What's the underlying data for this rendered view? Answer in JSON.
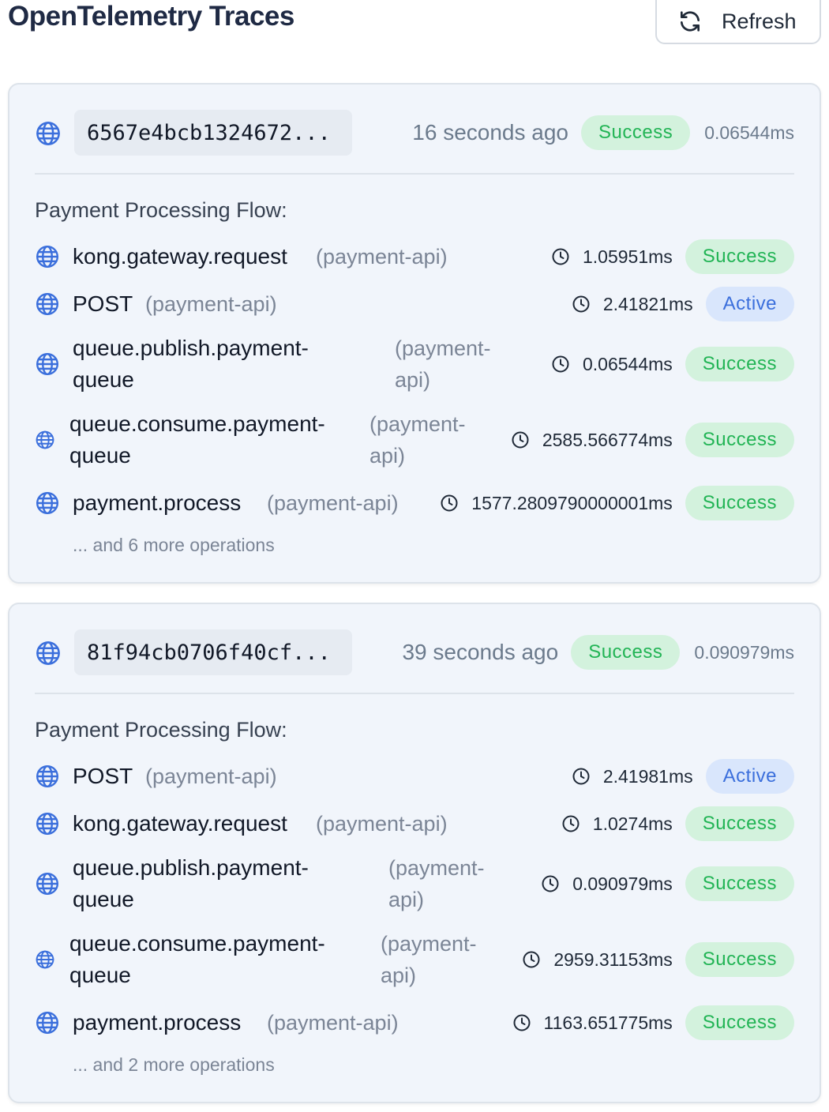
{
  "header": {
    "title": "OpenTelemetry Traces",
    "refresh_label": "Refresh",
    "refresh_icon": "refresh-icon"
  },
  "colors": {
    "success_bg": "#d3f2dd",
    "success_text": "#22b455",
    "active_bg": "#d9e6fc",
    "active_text": "#3b6fdc",
    "globe": "#3b6fdc"
  },
  "traces": [
    {
      "trace_id": "6567e4bcb1324672...",
      "time_ago": "16 seconds ago",
      "status": "Success",
      "duration": "0.06544ms",
      "flow_title": "Payment Processing Flow:",
      "spans": [
        {
          "name": "kong.gateway.request",
          "service": "(payment-api)",
          "duration": "1.05951ms",
          "status": "Success"
        },
        {
          "name": "POST",
          "service": "(payment-api)",
          "duration": "2.41821ms",
          "status": "Active"
        },
        {
          "name": "queue.publish.payment-queue",
          "service": "(payment-api)",
          "duration": "0.06544ms",
          "status": "Success"
        },
        {
          "name": "queue.consume.payment-queue",
          "service": "(payment-api)",
          "duration": "2585.566774ms",
          "status": "Success"
        },
        {
          "name": "payment.process",
          "service": "(payment-api)",
          "duration": "1577.2809790000001ms",
          "status": "Success"
        }
      ],
      "more_ops": "... and 6 more operations"
    },
    {
      "trace_id": "81f94cb0706f40cf...",
      "time_ago": "39 seconds ago",
      "status": "Success",
      "duration": "0.090979ms",
      "flow_title": "Payment Processing Flow:",
      "spans": [
        {
          "name": "POST",
          "service": "(payment-api)",
          "duration": "2.41981ms",
          "status": "Active"
        },
        {
          "name": "kong.gateway.request",
          "service": "(payment-api)",
          "duration": "1.0274ms",
          "status": "Success"
        },
        {
          "name": "queue.publish.payment-queue",
          "service": "(payment-api)",
          "duration": "0.090979ms",
          "status": "Success"
        },
        {
          "name": "queue.consume.payment-queue",
          "service": "(payment-api)",
          "duration": "2959.31153ms",
          "status": "Success"
        },
        {
          "name": "payment.process",
          "service": "(payment-api)",
          "duration": "1163.651775ms",
          "status": "Success"
        }
      ],
      "more_ops": "... and 2 more operations"
    }
  ]
}
